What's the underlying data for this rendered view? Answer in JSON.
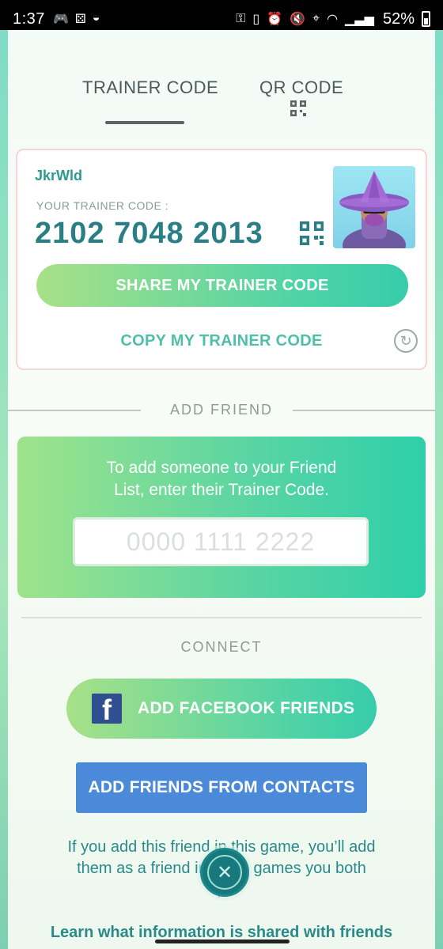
{
  "status_bar": {
    "time": "1:37",
    "battery_pct": "52%",
    "left_icons": [
      "game-controller-icon",
      "dice-icon",
      "sleep-icon"
    ],
    "right_icons": [
      "key-icon",
      "sim-icon",
      "alarm-icon",
      "mute-icon",
      "location-icon",
      "wifi-icon",
      "signal-icon"
    ]
  },
  "tabs": {
    "trainer_code": "TRAINER CODE",
    "qr_code": "QR CODE",
    "active": "trainer_code"
  },
  "card": {
    "trainer_name": "JkrWld",
    "code_label": "YOUR TRAINER CODE :",
    "code_value": "2102 7048 2013",
    "share_label": "SHARE MY TRAINER CODE",
    "copy_label": "COPY MY TRAINER CODE"
  },
  "add_friend": {
    "section_title": "ADD FRIEND",
    "instructions_line1": "To add someone to your Friend",
    "instructions_line2": "List, enter their Trainer Code.",
    "input_placeholder": "0000 1111 2222",
    "input_value": ""
  },
  "connect": {
    "section_title": "CONNECT",
    "facebook_label": "ADD FACEBOOK FRIENDS",
    "contacts_label": "ADD FRIENDS FROM CONTACTS"
  },
  "info": {
    "line1": "If you add this friend in this game, you’ll add",
    "line2": "them as a friend in a    ntic games you both",
    "line3": "p",
    "learn_more": "Learn what information is shared with friends"
  },
  "colors": {
    "accent_green": "#4fd3a6",
    "code_teal": "#2a7f86",
    "contacts_blue": "#4a8ad9",
    "facebook_blue": "#2f4f91"
  }
}
